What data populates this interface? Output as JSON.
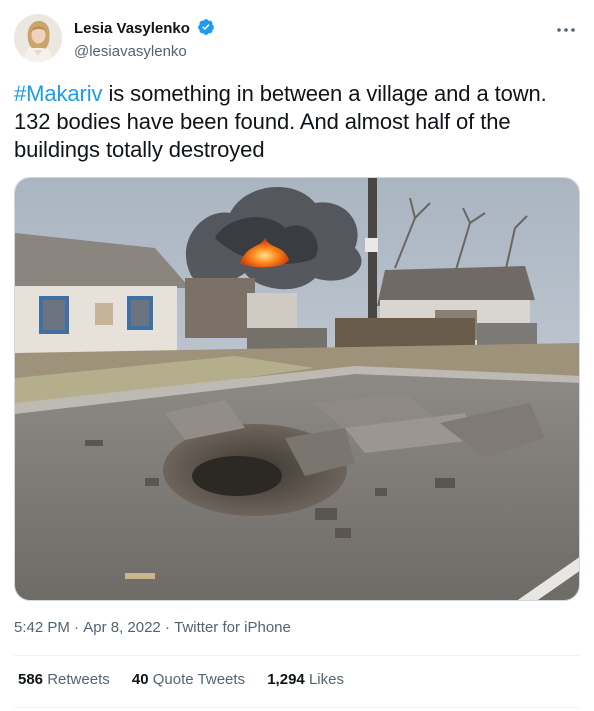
{
  "author": {
    "display_name": "Lesia Vasylenko",
    "handle": "@lesiavasylenko",
    "verified_icon": "verified-badge-icon",
    "avatar_icon": "avatar-portrait"
  },
  "more_icon": "more-options-icon",
  "tweet": {
    "hashtag": "#Makariv",
    "text_line1_rest": " is something in between a village and a town.",
    "text_line2": "132 bodies have been found. And almost half of the",
    "text_line3": "buildings totally destroyed",
    "image_subject": "photo-bomb-crater-destroyed-street"
  },
  "meta": {
    "time": "5:42 PM",
    "sep1": " · ",
    "date": "Apr 8, 2022",
    "sep2": " · ",
    "source": "Twitter for iPhone"
  },
  "stats": {
    "retweets_count": "586",
    "retweets_label": "Retweets",
    "quote_count": "40",
    "quote_label": "Quote Tweets",
    "likes_count": "1,294",
    "likes_label": "Likes"
  },
  "colors": {
    "link": "#1d9bf0",
    "text": "#0f1419",
    "secondary": "#536471"
  }
}
